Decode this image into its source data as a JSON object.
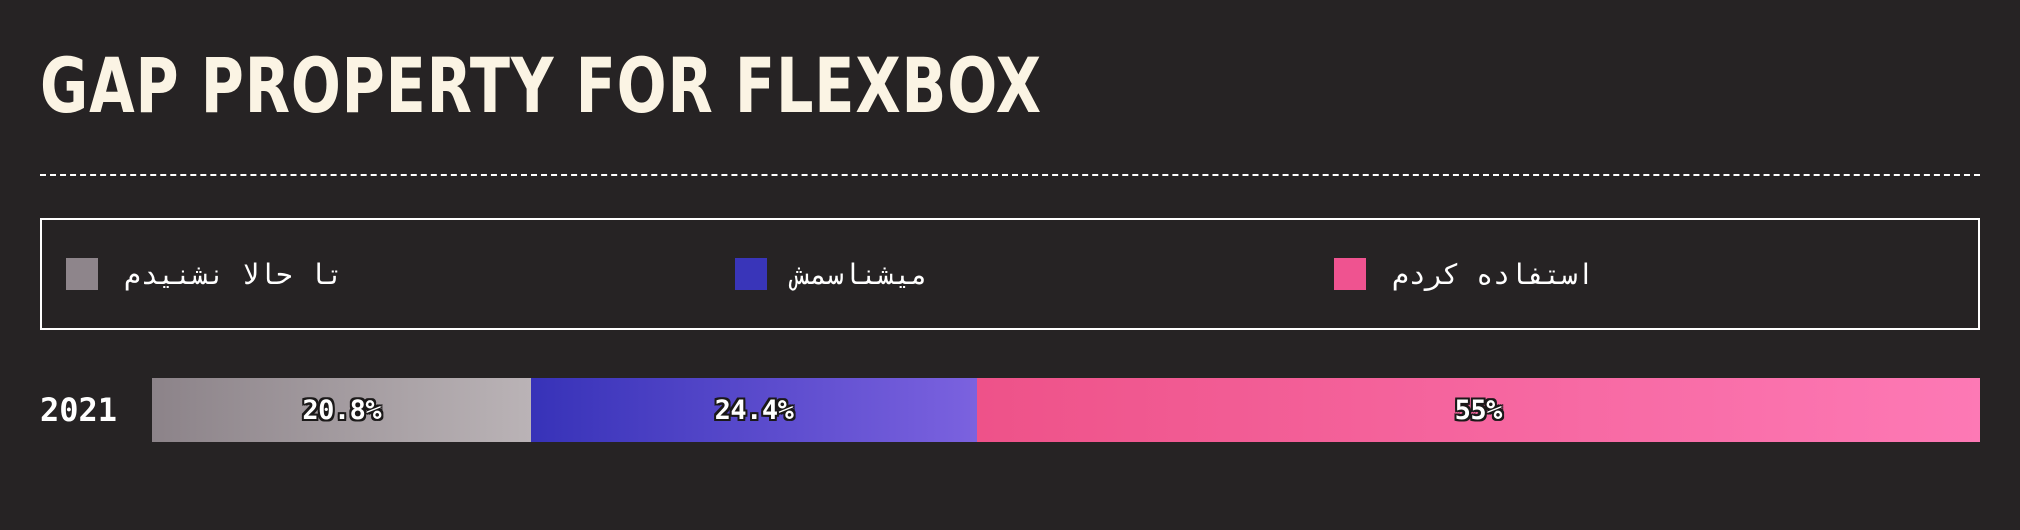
{
  "title": "GAP PROPERTY FOR FLEXBOX",
  "legend": [
    {
      "label": "تا حالا نشنیدم",
      "color": "#8e858b"
    },
    {
      "label": "میشناسمش",
      "color": "#3935b9"
    },
    {
      "label": "استفاده کردم",
      "color": "#ef5390"
    }
  ],
  "chart_data": {
    "type": "bar",
    "orientation": "horizontal",
    "stacked": true,
    "categories": [
      "2021"
    ],
    "series": [
      {
        "name": "تا حالا نشنیدم",
        "values": [
          20.8
        ],
        "display": "20.8%",
        "gradient": [
          "#8c8389",
          "#bab3b6"
        ]
      },
      {
        "name": "میشناسمش",
        "values": [
          24.4
        ],
        "display": "24.4%",
        "gradient": [
          "#3732b8",
          "#7b62df"
        ]
      },
      {
        "name": "استفاده کردم",
        "values": [
          55
        ],
        "display": "55%",
        "gradient": [
          "#ee5289",
          "#fd79b5"
        ]
      }
    ],
    "title": "GAP PROPERTY FOR FLEXBOX",
    "xlim": [
      0,
      100
    ],
    "unit": "%",
    "legend_position": "top",
    "grid": false
  }
}
